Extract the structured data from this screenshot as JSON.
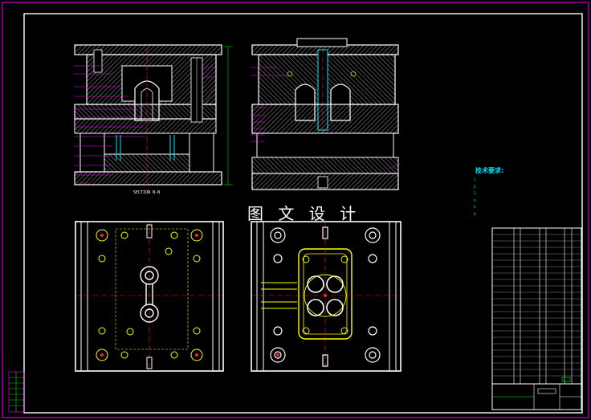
{
  "drawing": {
    "watermark": "图 文 设 计",
    "section_label": "SECTION  N-N",
    "technical_requirements": {
      "title": "技术要求:",
      "items": [
        "1.",
        "2.",
        "3.",
        "4.",
        "5.",
        "6."
      ]
    },
    "colors": {
      "background": "#000000",
      "outline": "#ffffff",
      "frame": "#ff00ff",
      "hatch": "#ffffff",
      "centerline": "#ff2020",
      "bolt": "#ffff00",
      "dimension": "#00ff00",
      "leader": "#ff00ff",
      "text_cyan": "#00e5ff"
    }
  }
}
